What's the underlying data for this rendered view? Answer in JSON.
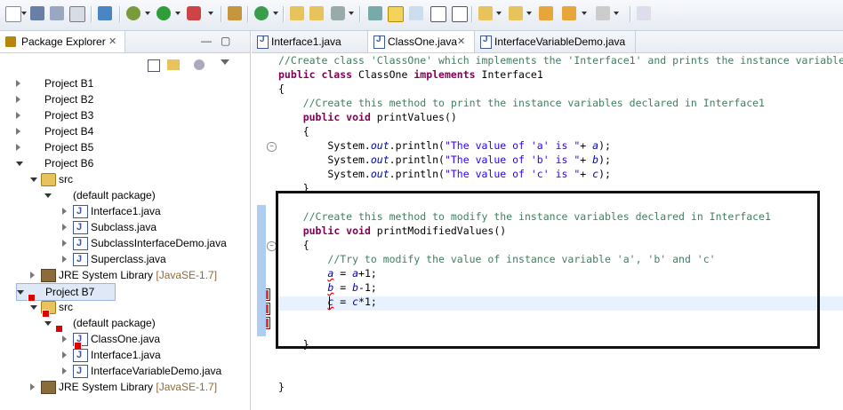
{
  "toolbar": {
    "icons": [
      "new-icon",
      "save-icon",
      "save-all-icon",
      "print-icon",
      "skip-breakpoints-icon",
      "debug-icon",
      "run-icon",
      "run-external-icon",
      "new-java-package-icon",
      "new-java-class-icon",
      "open-type-icon",
      "open-task-icon",
      "search-icon",
      "toggle-mark-occurrences-icon",
      "toggle-block-selection-icon",
      "show-whitespace-icon",
      "next-annotation-icon",
      "previous-annotation-icon",
      "last-edit-location-icon",
      "back-icon",
      "forward-icon",
      "pin-editor-icon"
    ]
  },
  "explorer": {
    "title": "Package Explorer",
    "close": "✕",
    "tree": [
      {
        "label": "Project B1",
        "type": "project"
      },
      {
        "label": "Project B2",
        "type": "project"
      },
      {
        "label": "Project B3",
        "type": "project"
      },
      {
        "label": "Project B4",
        "type": "project"
      },
      {
        "label": "Project B5",
        "type": "project"
      },
      {
        "label": "Project B6",
        "type": "project"
      },
      {
        "label": "src",
        "type": "src"
      },
      {
        "label": "(default package)",
        "type": "package"
      },
      {
        "label": "Interface1.java",
        "type": "java"
      },
      {
        "label": "Subclass.java",
        "type": "java"
      },
      {
        "label": "SubclassInterfaceDemo.java",
        "type": "java"
      },
      {
        "label": "Superclass.java",
        "type": "java"
      },
      {
        "label": "JRE System Library",
        "suffix": "[JavaSE-1.7]",
        "type": "jre"
      },
      {
        "label": "Project B7",
        "type": "project"
      },
      {
        "label": "src",
        "type": "src"
      },
      {
        "label": "(default package)",
        "type": "package"
      },
      {
        "label": "ClassOne.java",
        "type": "java"
      },
      {
        "label": "Interface1.java",
        "type": "java"
      },
      {
        "label": "InterfaceVariableDemo.java",
        "type": "java"
      },
      {
        "label": "JRE System Library",
        "suffix": "[JavaSE-1.7]",
        "type": "jre"
      }
    ]
  },
  "editor": {
    "tabs": [
      {
        "label": "Interface1.java"
      },
      {
        "label": "ClassOne.java",
        "close": "✕",
        "active": true
      },
      {
        "label": "InterfaceVariableDemo.java"
      }
    ],
    "lines": [
      [
        {
          "t": "//Create class 'ClassOne' which implements the 'Interface1' and prints the instance variables",
          "c": "cmt"
        }
      ],
      [
        {
          "t": "public class",
          "c": "kw"
        },
        {
          "t": " ClassOne "
        },
        {
          "t": "implements",
          "c": "kw"
        },
        {
          "t": " Interface1"
        }
      ],
      [
        {
          "t": "{"
        }
      ],
      [
        {
          "t": "    "
        },
        {
          "t": "//Create this method to print the instance variables declared in Interface1",
          "c": "cmt"
        }
      ],
      [
        {
          "t": "    "
        },
        {
          "t": "public void",
          "c": "kw"
        },
        {
          "t": " printValues()"
        }
      ],
      [
        {
          "t": "    {"
        }
      ],
      [
        {
          "t": "        System."
        },
        {
          "t": "out",
          "c": "fld"
        },
        {
          "t": ".println("
        },
        {
          "t": "\"The value of 'a' is \"",
          "c": "str"
        },
        {
          "t": "+ "
        },
        {
          "t": "a",
          "c": "fld"
        },
        {
          "t": ");"
        }
      ],
      [
        {
          "t": "        System."
        },
        {
          "t": "out",
          "c": "fld"
        },
        {
          "t": ".println("
        },
        {
          "t": "\"The value of 'b' is \"",
          "c": "str"
        },
        {
          "t": "+ "
        },
        {
          "t": "b",
          "c": "fld"
        },
        {
          "t": ");"
        }
      ],
      [
        {
          "t": "        System."
        },
        {
          "t": "out",
          "c": "fld"
        },
        {
          "t": ".println("
        },
        {
          "t": "\"The value of 'c' is \"",
          "c": "str"
        },
        {
          "t": "+ "
        },
        {
          "t": "c",
          "c": "fld"
        },
        {
          "t": ");"
        }
      ],
      [
        {
          "t": "    }"
        }
      ],
      [
        {
          "t": ""
        }
      ],
      [
        {
          "t": "    "
        },
        {
          "t": "//Create this method to modify the instance variables declared in Interface1",
          "c": "cmt"
        }
      ],
      [
        {
          "t": "    "
        },
        {
          "t": "public void",
          "c": "kw"
        },
        {
          "t": " printModifiedValues()"
        }
      ],
      [
        {
          "t": "    {"
        }
      ],
      [
        {
          "t": "        "
        },
        {
          "t": "//Try to modify the value of instance variable 'a', 'b' and 'c'",
          "c": "cmt"
        }
      ],
      [
        {
          "t": "        "
        },
        {
          "t": "a",
          "c": "fld squig"
        },
        {
          "t": " = "
        },
        {
          "t": "a",
          "c": "fld"
        },
        {
          "t": "+1;"
        }
      ],
      [
        {
          "t": "        "
        },
        {
          "t": "b",
          "c": "fld squig"
        },
        {
          "t": " = "
        },
        {
          "t": "b",
          "c": "fld"
        },
        {
          "t": "-1;"
        }
      ],
      [
        {
          "t": "        "
        },
        {
          "t": "c",
          "c": "fld squig"
        },
        {
          "t": " = "
        },
        {
          "t": "c",
          "c": "fld"
        },
        {
          "t": "*1;"
        }
      ],
      [
        {
          "t": ""
        }
      ],
      [
        {
          "t": ""
        }
      ],
      [
        {
          "t": "    }"
        }
      ],
      [
        {
          "t": ""
        }
      ],
      [
        {
          "t": ""
        }
      ],
      [
        {
          "t": "}"
        }
      ]
    ]
  }
}
